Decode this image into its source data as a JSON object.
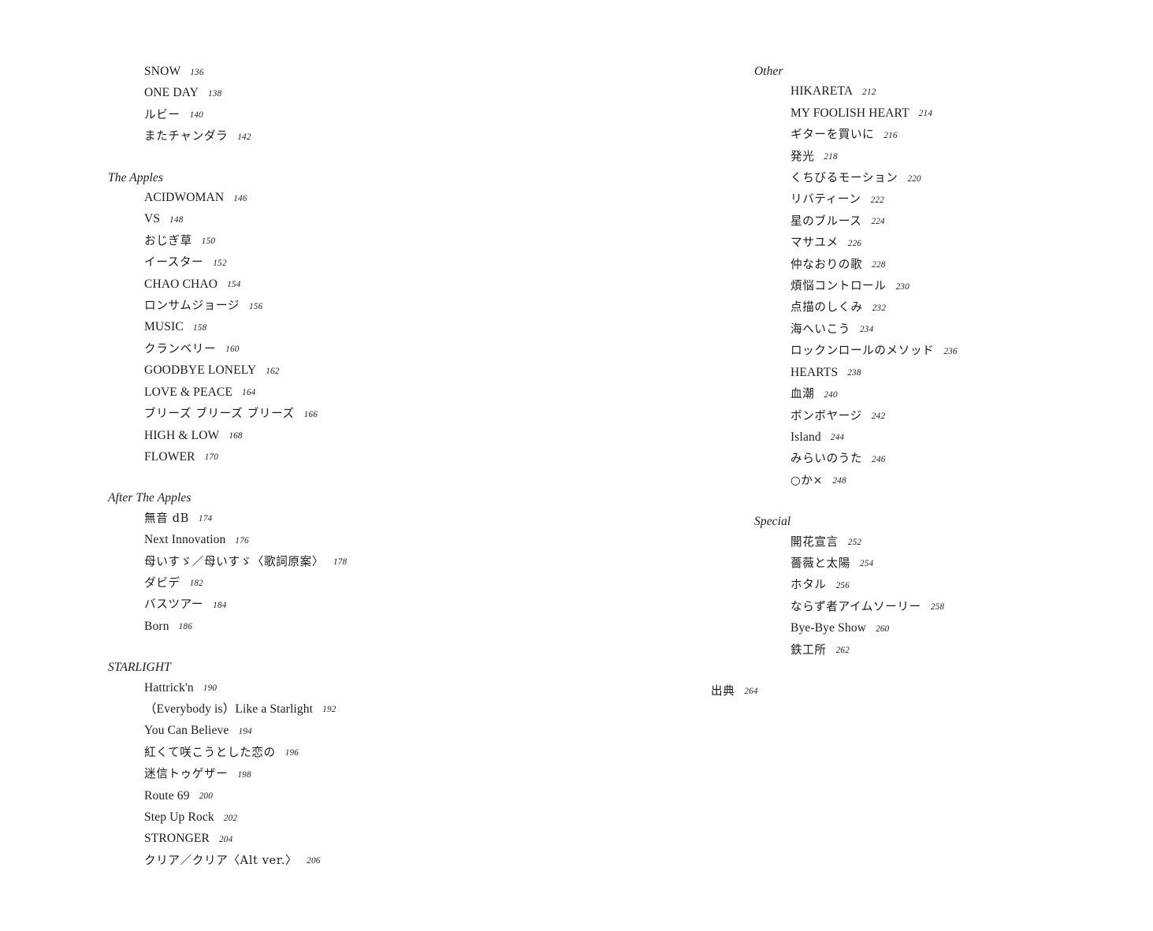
{
  "document": {
    "type": "table-of-contents",
    "background_color": "#ffffff",
    "text_color": "#1a1a1a"
  },
  "columns": [
    {
      "id": "left-column",
      "sections": [
        {
          "title": null,
          "entries": [
            {
              "title": "SNOW",
              "page": "136",
              "script": "latin"
            },
            {
              "title": "ONE DAY",
              "page": "138",
              "script": "latin"
            },
            {
              "title": "ルビー",
              "page": "140",
              "script": "jp"
            },
            {
              "title": "またチャンダラ",
              "page": "142",
              "script": "jp"
            }
          ]
        },
        {
          "title": "The Apples",
          "entries": [
            {
              "title": "ACIDWOMAN",
              "page": "146",
              "script": "latin"
            },
            {
              "title": "VS",
              "page": "148",
              "script": "latin"
            },
            {
              "title": "おじぎ草",
              "page": "150",
              "script": "jp"
            },
            {
              "title": "イースター",
              "page": "152",
              "script": "jp"
            },
            {
              "title": "CHAO CHAO",
              "page": "154",
              "script": "latin"
            },
            {
              "title": "ロンサムジョージ",
              "page": "156",
              "script": "jp"
            },
            {
              "title": "MUSIC",
              "page": "158",
              "script": "latin"
            },
            {
              "title": "クランベリー",
              "page": "160",
              "script": "jp"
            },
            {
              "title": "GOODBYE LONELY",
              "page": "162",
              "script": "latin"
            },
            {
              "title": "LOVE & PEACE",
              "page": "164",
              "script": "latin"
            },
            {
              "title": "ブリーズ ブリーズ ブリーズ",
              "page": "166",
              "script": "jp"
            },
            {
              "title": "HIGH & LOW",
              "page": "168",
              "script": "latin"
            },
            {
              "title": "FLOWER",
              "page": "170",
              "script": "latin"
            }
          ]
        },
        {
          "title": "After The Apples",
          "entries": [
            {
              "title": "無音 dB",
              "page": "174",
              "script": "jp"
            },
            {
              "title": "Next Innovation",
              "page": "176",
              "script": "latin"
            },
            {
              "title": "母いすゞ／母いすゞ〈歌詞原案〉",
              "page": "178",
              "script": "jp"
            },
            {
              "title": "ダビデ",
              "page": "182",
              "script": "jp"
            },
            {
              "title": "バスツアー",
              "page": "184",
              "script": "jp"
            },
            {
              "title": "Born",
              "page": "186",
              "script": "latin"
            }
          ]
        },
        {
          "title": "STARLIGHT",
          "entries": [
            {
              "title": "Hattrick'n",
              "page": "190",
              "script": "latin"
            },
            {
              "title": "（Everybody is）Like a Starlight",
              "page": "192",
              "script": "latin"
            },
            {
              "title": "You Can Believe",
              "page": "194",
              "script": "latin"
            },
            {
              "title": "紅くて咲こうとした恋の",
              "page": "196",
              "script": "jp"
            },
            {
              "title": "迷信トゥゲザー",
              "page": "198",
              "script": "jp"
            },
            {
              "title": "Route 69",
              "page": "200",
              "script": "latin"
            },
            {
              "title": "Step Up Rock",
              "page": "202",
              "script": "latin"
            },
            {
              "title": "STRONGER",
              "page": "204",
              "script": "latin"
            },
            {
              "title": "クリア／クリア〈Alt ver.〉",
              "page": "206",
              "script": "jp"
            }
          ]
        }
      ]
    },
    {
      "id": "right-column",
      "sections": [
        {
          "title": "Other",
          "entries": [
            {
              "title": "HIKARETA",
              "page": "212",
              "script": "latin"
            },
            {
              "title": "MY FOOLISH HEART",
              "page": "214",
              "script": "latin"
            },
            {
              "title": "ギターを買いに",
              "page": "216",
              "script": "jp"
            },
            {
              "title": "発光",
              "page": "218",
              "script": "jp"
            },
            {
              "title": "くちびるモーション",
              "page": "220",
              "script": "jp"
            },
            {
              "title": "リバティーン",
              "page": "222",
              "script": "jp"
            },
            {
              "title": "星のブルース",
              "page": "224",
              "script": "jp"
            },
            {
              "title": "マサユメ",
              "page": "226",
              "script": "jp"
            },
            {
              "title": "仲なおりの歌",
              "page": "228",
              "script": "jp"
            },
            {
              "title": "煩悩コントロール",
              "page": "230",
              "script": "jp"
            },
            {
              "title": "点描のしくみ",
              "page": "232",
              "script": "jp"
            },
            {
              "title": "海へいこう",
              "page": "234",
              "script": "jp"
            },
            {
              "title": "ロックンロールのメソッド",
              "page": "236",
              "script": "jp"
            },
            {
              "title": "HEARTS",
              "page": "238",
              "script": "latin"
            },
            {
              "title": "血潮",
              "page": "240",
              "script": "jp"
            },
            {
              "title": "ボンボヤージ",
              "page": "242",
              "script": "jp"
            },
            {
              "title": "Island",
              "page": "244",
              "script": "latin"
            },
            {
              "title": "みらいのうた",
              "page": "246",
              "script": "jp"
            },
            {
              "title": "○か×",
              "page": "248",
              "script": "jp"
            }
          ]
        },
        {
          "title": "Special",
          "entries": [
            {
              "title": "開花宣言",
              "page": "252",
              "script": "jp"
            },
            {
              "title": "薔薇と太陽",
              "page": "254",
              "script": "jp"
            },
            {
              "title": "ホタル",
              "page": "256",
              "script": "jp"
            },
            {
              "title": "ならず者アイムソーリー",
              "page": "258",
              "script": "jp"
            },
            {
              "title": "Bye-Bye Show",
              "page": "260",
              "script": "latin"
            },
            {
              "title": "鉄工所",
              "page": "262",
              "script": "jp"
            }
          ]
        }
      ],
      "standalone": {
        "title": "出典",
        "page": "264",
        "script": "jp"
      }
    }
  ]
}
